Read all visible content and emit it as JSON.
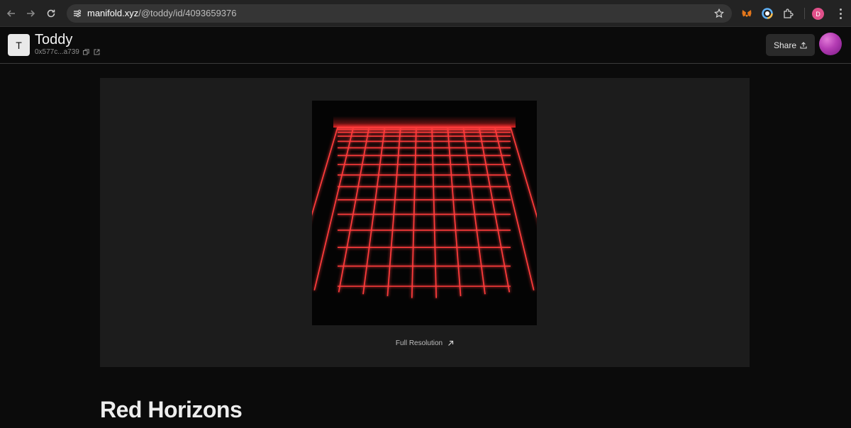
{
  "browser": {
    "url_host": "manifold.xyz",
    "url_path": "/@toddy/id/4093659376",
    "profile_initial": "D",
    "icons": [
      "back-arrow-icon",
      "forward-arrow-icon",
      "reload-icon",
      "site-info-icon",
      "bookmark-star-icon",
      "metamask-extension-icon",
      "color-extension-icon",
      "extensions-puzzle-icon",
      "kebab-menu-icon"
    ]
  },
  "header": {
    "avatar_letter": "T",
    "creator_name": "Toddy",
    "address": "0x577c...a739",
    "share_label": "Share"
  },
  "artwork": {
    "full_resolution_label": "Full Resolution",
    "grid_color": "#ff3b3b"
  },
  "page": {
    "title": "Red Horizons"
  }
}
